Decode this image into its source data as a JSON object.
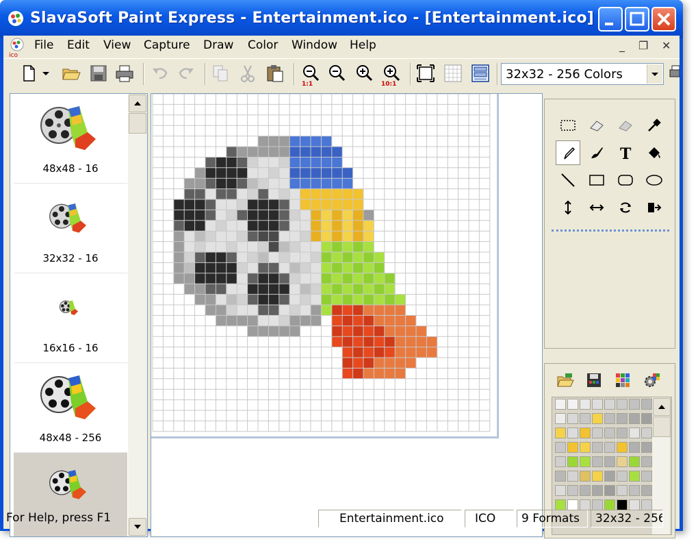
{
  "window": {
    "title": "SlavaSoft Paint Express - Entertainment.ico - [Entertainment.ico]",
    "minimize_icon": "minimize-icon",
    "maximize_icon": "maximize-icon",
    "close_icon": "close-icon"
  },
  "menu": {
    "items": [
      "File",
      "Edit",
      "View",
      "Capture",
      "Draw",
      "Color",
      "Window",
      "Help"
    ],
    "mdi_minimize": "_",
    "mdi_restore": "❐",
    "mdi_close": "✕"
  },
  "toolbar": {
    "buttons": [
      "new-icon",
      "dropdown-arrow-icon",
      "open-folder-icon",
      "save-icon",
      "print-icon",
      "undo-icon",
      "redo-icon",
      "copy-icon",
      "cut-icon",
      "paste-icon",
      "zoom-actual-icon",
      "zoom-out-icon",
      "zoom-in-icon",
      "zoom-10x-icon",
      "fit-icon",
      "grid-icon",
      "toggle-panes-icon",
      "print-preview-icon"
    ],
    "zoom_actual_label": "1:1",
    "zoom_10x_label": "10:1",
    "format_combo": {
      "selected": "32x32 - 256 Colors"
    }
  },
  "formats": [
    {
      "label": "48x48 - 16",
      "selected": false
    },
    {
      "label": "32x32 - 16",
      "selected": false
    },
    {
      "label": "16x16 - 16",
      "selected": false
    },
    {
      "label": "48x48 - 256",
      "selected": false
    },
    {
      "label": "",
      "selected": true
    }
  ],
  "tools": [
    "rect-select-icon",
    "eraser-icon",
    "color-eraser-icon",
    "eyedropper-icon",
    "pencil-icon",
    "brush-icon",
    "text-icon",
    "fill-icon",
    "line-icon",
    "rectangle-icon",
    "rounded-rect-icon",
    "ellipse-icon",
    "flip-vertical-icon",
    "flip-horizontal-icon",
    "rotate-icon",
    "shift-icon"
  ],
  "text_tool_glyph": "T",
  "palette_tools": [
    "open-palette-icon",
    "save-palette-icon",
    "palette-grid-icon",
    "palette-settings-icon"
  ],
  "palette_colors": [
    [
      "#f2f2f2",
      "#f2f2f2",
      "#e8e8e8",
      "#dedede",
      "#d6d6d6",
      "#cccccc",
      "#c2c2c2",
      "#b8b8b8"
    ],
    [
      "#ececec",
      "#d8d8d8",
      "#c8c8c8",
      "#f4d24a",
      "#bdbdbd",
      "#b3b3b3",
      "#a9a9a9",
      "#a0a0a0"
    ],
    [
      "#f4d24a",
      "#dcdcdc",
      "#f2c230",
      "#cdcdcd",
      "#c4c4c4",
      "#bababa",
      "#e4e4e4",
      "#d0d0d0"
    ],
    [
      "#c8c8c8",
      "#f2c230",
      "#f4d24a",
      "#c0c0c0",
      "#c6c6c6",
      "#f2c230",
      "#b0b0b0",
      "#a8a8a8"
    ],
    [
      "#cfcfcf",
      "#9ad835",
      "#a8e040",
      "#bcbcbc",
      "#b2b2b2",
      "#e8d090",
      "#9ad835",
      "#b8b8b8"
    ],
    [
      "#b8b8b8",
      "#d4d4d4",
      "#e0c060",
      "#f4d24a",
      "#a4a4a4",
      "#cacaca",
      "#a6e040",
      "#c2c2c2"
    ],
    [
      "#dcdcdc",
      "#c6c6c6",
      "#b4b4b4",
      "#a8a8a8",
      "#9c9c9c",
      "#d2d2d2",
      "#c0c0c0",
      "#b0b0b0"
    ],
    [
      "#a8e040",
      "#ffffff",
      "#d8d8d8",
      "#c8c8c8",
      "#9ad835",
      "#000000",
      "#e0e0e0",
      "#cfcfcf"
    ]
  ],
  "status": {
    "help": "For Help, press F1",
    "file": "Entertainment.ico",
    "type": "ICO",
    "formats": "9 Formats",
    "size": "32x32 - 256"
  }
}
